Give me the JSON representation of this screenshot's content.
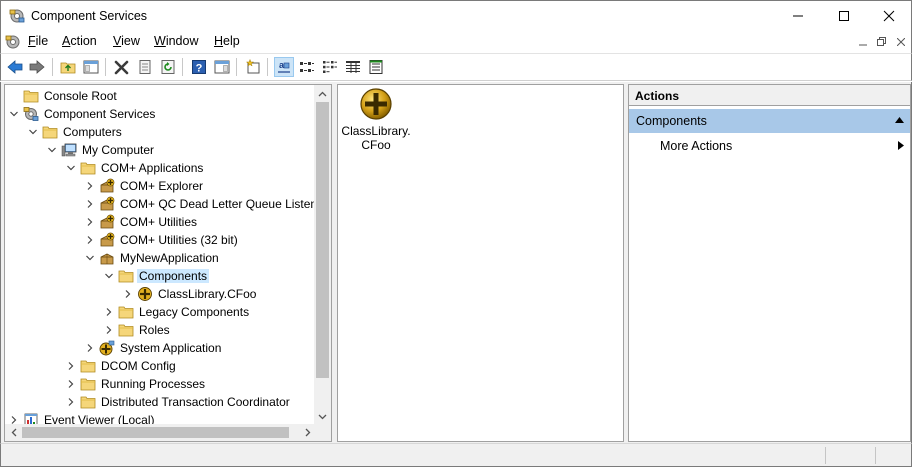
{
  "window": {
    "title": "Component Services"
  },
  "menu": {
    "items": [
      {
        "label": "File",
        "accel": "F",
        "rest": "ile"
      },
      {
        "label": "Action",
        "accel": "A",
        "rest": "ction"
      },
      {
        "label": "View",
        "accel": "V",
        "rest": "iew"
      },
      {
        "label": "Window",
        "accel": "W",
        "rest": "indow"
      },
      {
        "label": "Help",
        "accel": "H",
        "rest": "elp"
      }
    ]
  },
  "tree": {
    "nodes": [
      {
        "label": "Console Root",
        "icon": "folder-icon"
      },
      {
        "label": "Component Services",
        "icon": "component-services-icon"
      },
      {
        "label": "Computers",
        "icon": "folder-icon"
      },
      {
        "label": "My Computer",
        "icon": "my-computer-icon"
      },
      {
        "label": "COM+ Applications",
        "icon": "folder-icon"
      },
      {
        "label": "COM+ Explorer",
        "icon": "com-application-icon"
      },
      {
        "label": "COM+ QC Dead Letter Queue Listener",
        "icon": "com-application-icon"
      },
      {
        "label": "COM+ Utilities",
        "icon": "com-application-icon"
      },
      {
        "label": "COM+ Utilities (32 bit)",
        "icon": "com-application-icon"
      },
      {
        "label": "MyNewApplication",
        "icon": "package-icon"
      },
      {
        "label": "Components",
        "icon": "folder-icon"
      },
      {
        "label": "ClassLibrary.CFoo",
        "icon": "component-icon"
      },
      {
        "label": "Legacy Components",
        "icon": "folder-icon"
      },
      {
        "label": "Roles",
        "icon": "folder-icon"
      },
      {
        "label": "System Application",
        "icon": "system-application-icon"
      },
      {
        "label": "DCOM Config",
        "icon": "folder-icon"
      },
      {
        "label": "Running Processes",
        "icon": "folder-icon"
      },
      {
        "label": "Distributed Transaction Coordinator",
        "icon": "folder-icon"
      },
      {
        "label": "Event Viewer (Local)",
        "icon": "event-viewer-icon"
      }
    ]
  },
  "content": {
    "items": [
      {
        "line1": "ClassLibrary.",
        "line2": "CFoo",
        "icon": "component-icon"
      }
    ]
  },
  "actions": {
    "header": "Actions",
    "section": "Components",
    "more": "More Actions"
  },
  "colors": {
    "selection": "#cce8ff",
    "actions_section": "#a8c8e8",
    "folder": "#f5d67a",
    "component_gold": "#d4a017"
  }
}
